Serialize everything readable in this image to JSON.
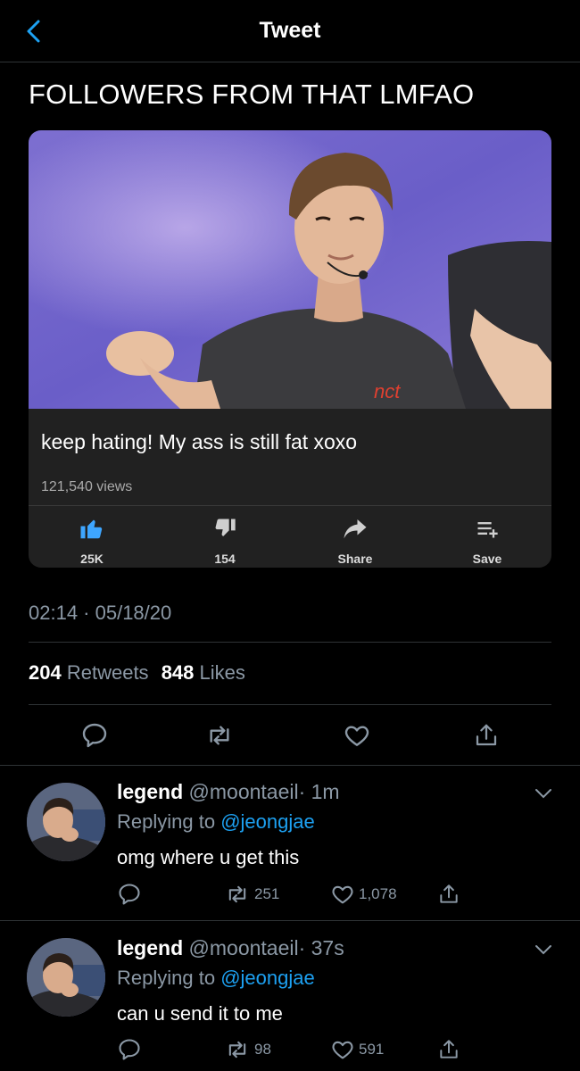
{
  "header": {
    "title": "Tweet",
    "back_icon": "chevron-left-icon"
  },
  "tweet": {
    "text": "FOLLOWERS FROM THAT LMFAO",
    "timestamp": "02:14 · 05/18/20",
    "retweets": "204",
    "retweets_label": "Retweets",
    "likes": "848",
    "likes_label": "Likes"
  },
  "embed": {
    "video_title": "keep hating! My ass is still fat xoxo",
    "views": "121,540 views",
    "logo_text": "nct",
    "like_count": "25K",
    "dislike_count": "154",
    "share_label": "Share",
    "save_label": "Save"
  },
  "replies": [
    {
      "name": "legend",
      "handle": "@moontaeil",
      "time": "· 1m",
      "replying_prefix": "Replying to",
      "replying_to": "@jeongjae",
      "text": "omg where u get this",
      "retweets": "251",
      "likes": "1,078"
    },
    {
      "name": "legend",
      "handle": "@moontaeil",
      "time": "· 37s",
      "replying_prefix": "Replying to",
      "replying_to": "@jeongjae",
      "text": "can u send it to me",
      "retweets": "98",
      "likes": "591"
    }
  ],
  "colors": {
    "accent": "#1da1f2",
    "muted": "#8b98a5",
    "background": "#000000",
    "youtube_like": "#3ea6ff"
  }
}
